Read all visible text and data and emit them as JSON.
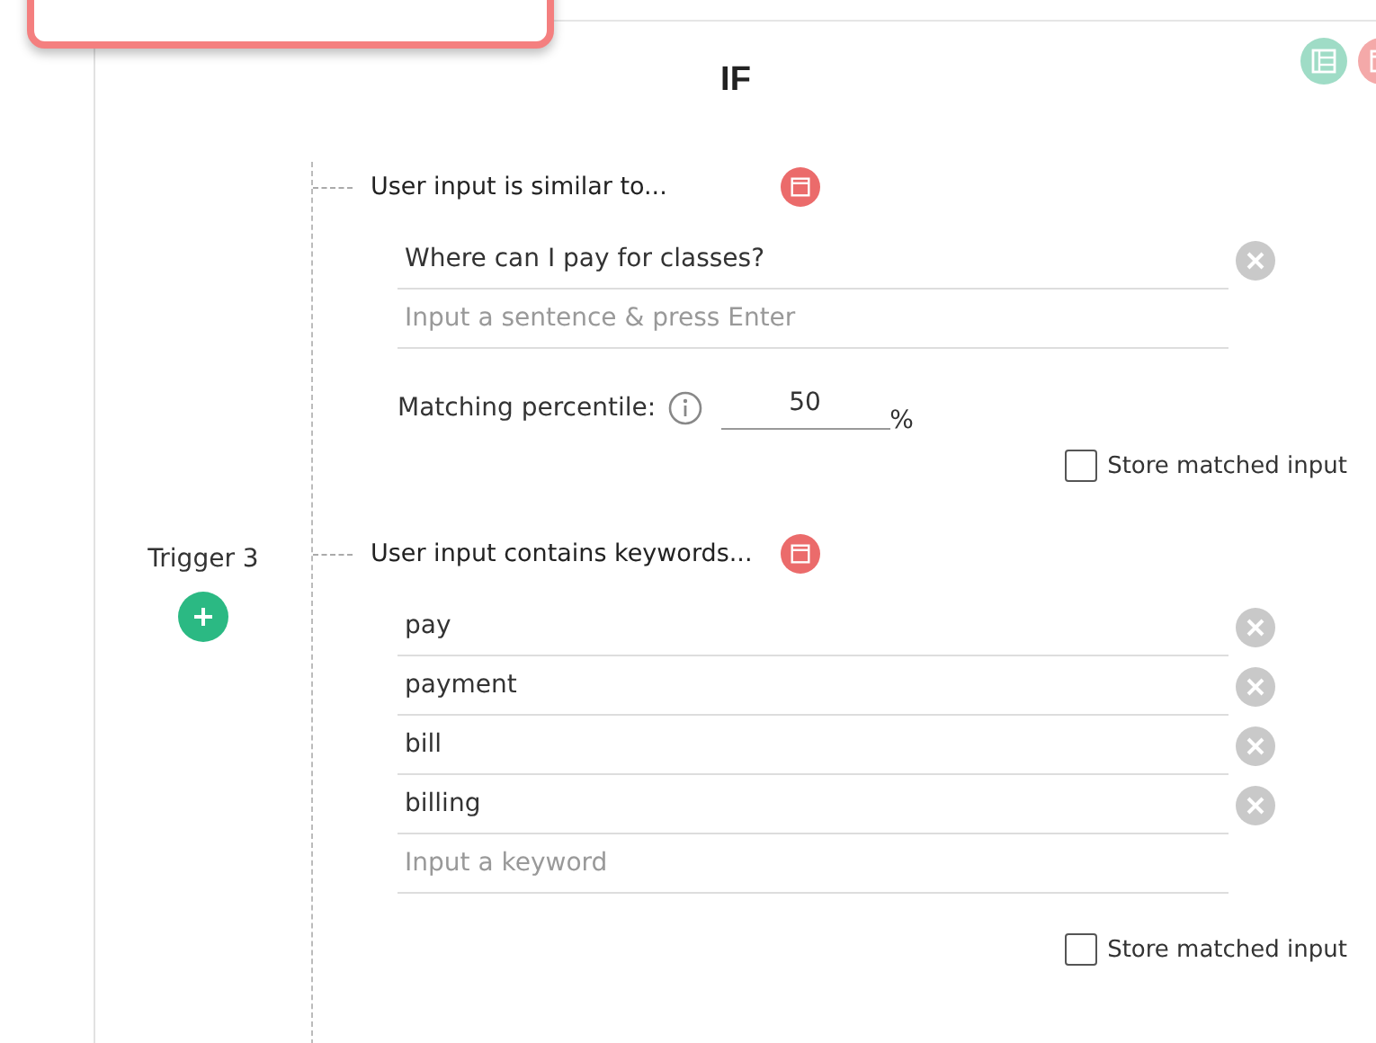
{
  "title": "IF",
  "trigger": {
    "label": "Trigger 3"
  },
  "conditions": [
    {
      "kind": "similar",
      "title": "User input is similar to...",
      "entries": [
        "Where can I pay for classes?"
      ],
      "placeholder": "Input a sentence & press Enter",
      "percentile": {
        "label": "Matching percentile:",
        "value": "50",
        "unit": "%"
      },
      "store": {
        "label": "Store matched input",
        "checked": false
      }
    },
    {
      "kind": "keywords",
      "title": "User input contains keywords...",
      "entries": [
        "pay",
        "payment",
        "bill",
        "billing"
      ],
      "placeholder": "Input a keyword",
      "store": {
        "label": "Store matched input",
        "checked": false
      }
    }
  ]
}
